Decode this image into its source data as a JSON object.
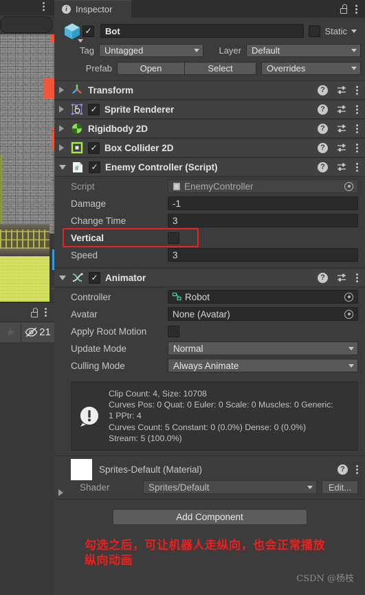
{
  "tab": {
    "label": "Inspector",
    "icon": "info-icon",
    "lock_icon": "unlocked-padlock-icon",
    "menu_icon": "kebab-menu-icon"
  },
  "gameobject": {
    "icon": "cube-icon",
    "enabled_check": "✓",
    "name": "Bot",
    "static_label": "Static",
    "tag_label": "Tag",
    "tag_value": "Untagged",
    "layer_label": "Layer",
    "layer_value": "Default",
    "prefab_label": "Prefab",
    "prefab_open": "Open",
    "prefab_select": "Select",
    "prefab_overrides": "Overrides"
  },
  "components": [
    {
      "title": "Transform",
      "icon": "transform-axis-icon",
      "expanded": false,
      "has_checkbox": false
    },
    {
      "title": "Sprite Renderer",
      "icon": "sprite-renderer-icon",
      "expanded": false,
      "has_checkbox": true,
      "checked": true
    },
    {
      "title": "Rigidbody 2D",
      "icon": "rigidbody-2d-icon",
      "expanded": false,
      "has_checkbox": false
    },
    {
      "title": "Box Collider 2D",
      "icon": "box-collider-2d-icon",
      "expanded": false,
      "has_checkbox": true,
      "checked": true
    },
    {
      "title": "Enemy Controller (Script)",
      "icon": "csharp-script-icon",
      "expanded": true,
      "has_checkbox": true,
      "checked": true
    }
  ],
  "enemy_controller": {
    "rows": [
      {
        "label": "Script",
        "value": "EnemyController",
        "type": "object",
        "readonly": true,
        "icon": "script-asset-icon"
      },
      {
        "label": "Damage",
        "value": "-1",
        "type": "text"
      },
      {
        "label": "Change Time",
        "value": "3",
        "type": "text"
      },
      {
        "label": "Vertical",
        "value": "",
        "type": "checkbox",
        "checked": false,
        "highlighted": true
      },
      {
        "label": "Speed",
        "value": "3",
        "type": "text"
      }
    ]
  },
  "animator": {
    "title": "Animator",
    "icon": "animator-icon",
    "checked": true,
    "rows": [
      {
        "label": "Controller",
        "value": "Robot",
        "type": "object",
        "icon": "animator-controller-asset-icon"
      },
      {
        "label": "Avatar",
        "value": "None (Avatar)",
        "type": "object"
      },
      {
        "label": "Apply Root Motion",
        "value": "",
        "type": "checkbox",
        "checked": false
      },
      {
        "label": "Update Mode",
        "value": "Normal",
        "type": "dropdown"
      },
      {
        "label": "Culling Mode",
        "value": "Always Animate",
        "type": "dropdown"
      }
    ],
    "info": {
      "icon": "warning-icon",
      "lines": [
        "Clip Count: 4, Size: 10708",
        "Curves Pos: 0 Quat: 0 Euler: 0 Scale: 0 Muscles: 0 Generic:",
        "1 PPtr: 4",
        "Curves Count: 5 Constant: 0 (0.0%) Dense: 0 (0.0%)",
        "Stream: 5 (100.0%)"
      ]
    }
  },
  "material": {
    "title": "Sprites-Default (Material)",
    "swatch_color": "#ffffff",
    "shader_label": "Shader",
    "shader_value": "Sprites/Default",
    "edit_label": "Edit..."
  },
  "add_component_label": "Add Component",
  "annotation": {
    "line1": "勾选之后，可让机器人走纵向，也会正常播放",
    "line2": "纵向动画",
    "color": "#ee1f1f",
    "watermark": "CSDN @杨枝"
  },
  "left_panel": {
    "visibility_count": "21",
    "star_icon": "favorite-star-icon",
    "eye_icon": "hidden-eye-icon",
    "lock_icon": "unlocked-padlock-icon",
    "menu_icon": "kebab-menu-icon"
  }
}
